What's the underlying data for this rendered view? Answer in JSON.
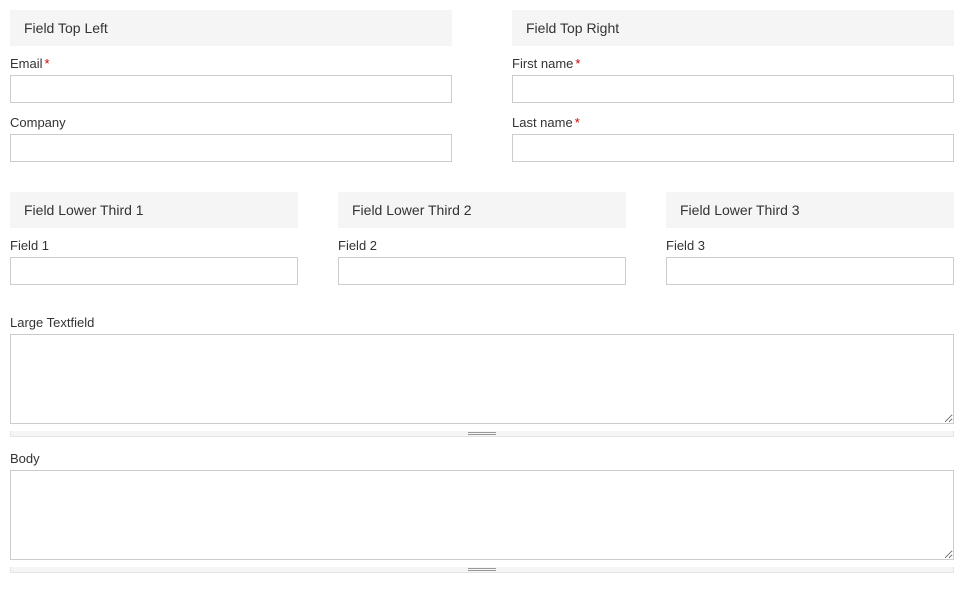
{
  "top_left": {
    "header": "Field Top Left",
    "email_label": "Email",
    "email_required": "*",
    "company_label": "Company"
  },
  "top_right": {
    "header": "Field Top Right",
    "first_name_label": "First name",
    "first_name_required": "*",
    "last_name_label": "Last name",
    "last_name_required": "*"
  },
  "lower_third_1": {
    "header": "Field Lower Third 1",
    "field_label": "Field 1"
  },
  "lower_third_2": {
    "header": "Field Lower Third 2",
    "field_label": "Field 2"
  },
  "lower_third_3": {
    "header": "Field Lower Third 3",
    "field_label": "Field 3"
  },
  "large_textfield_label": "Large Textfield",
  "body_label": "Body"
}
